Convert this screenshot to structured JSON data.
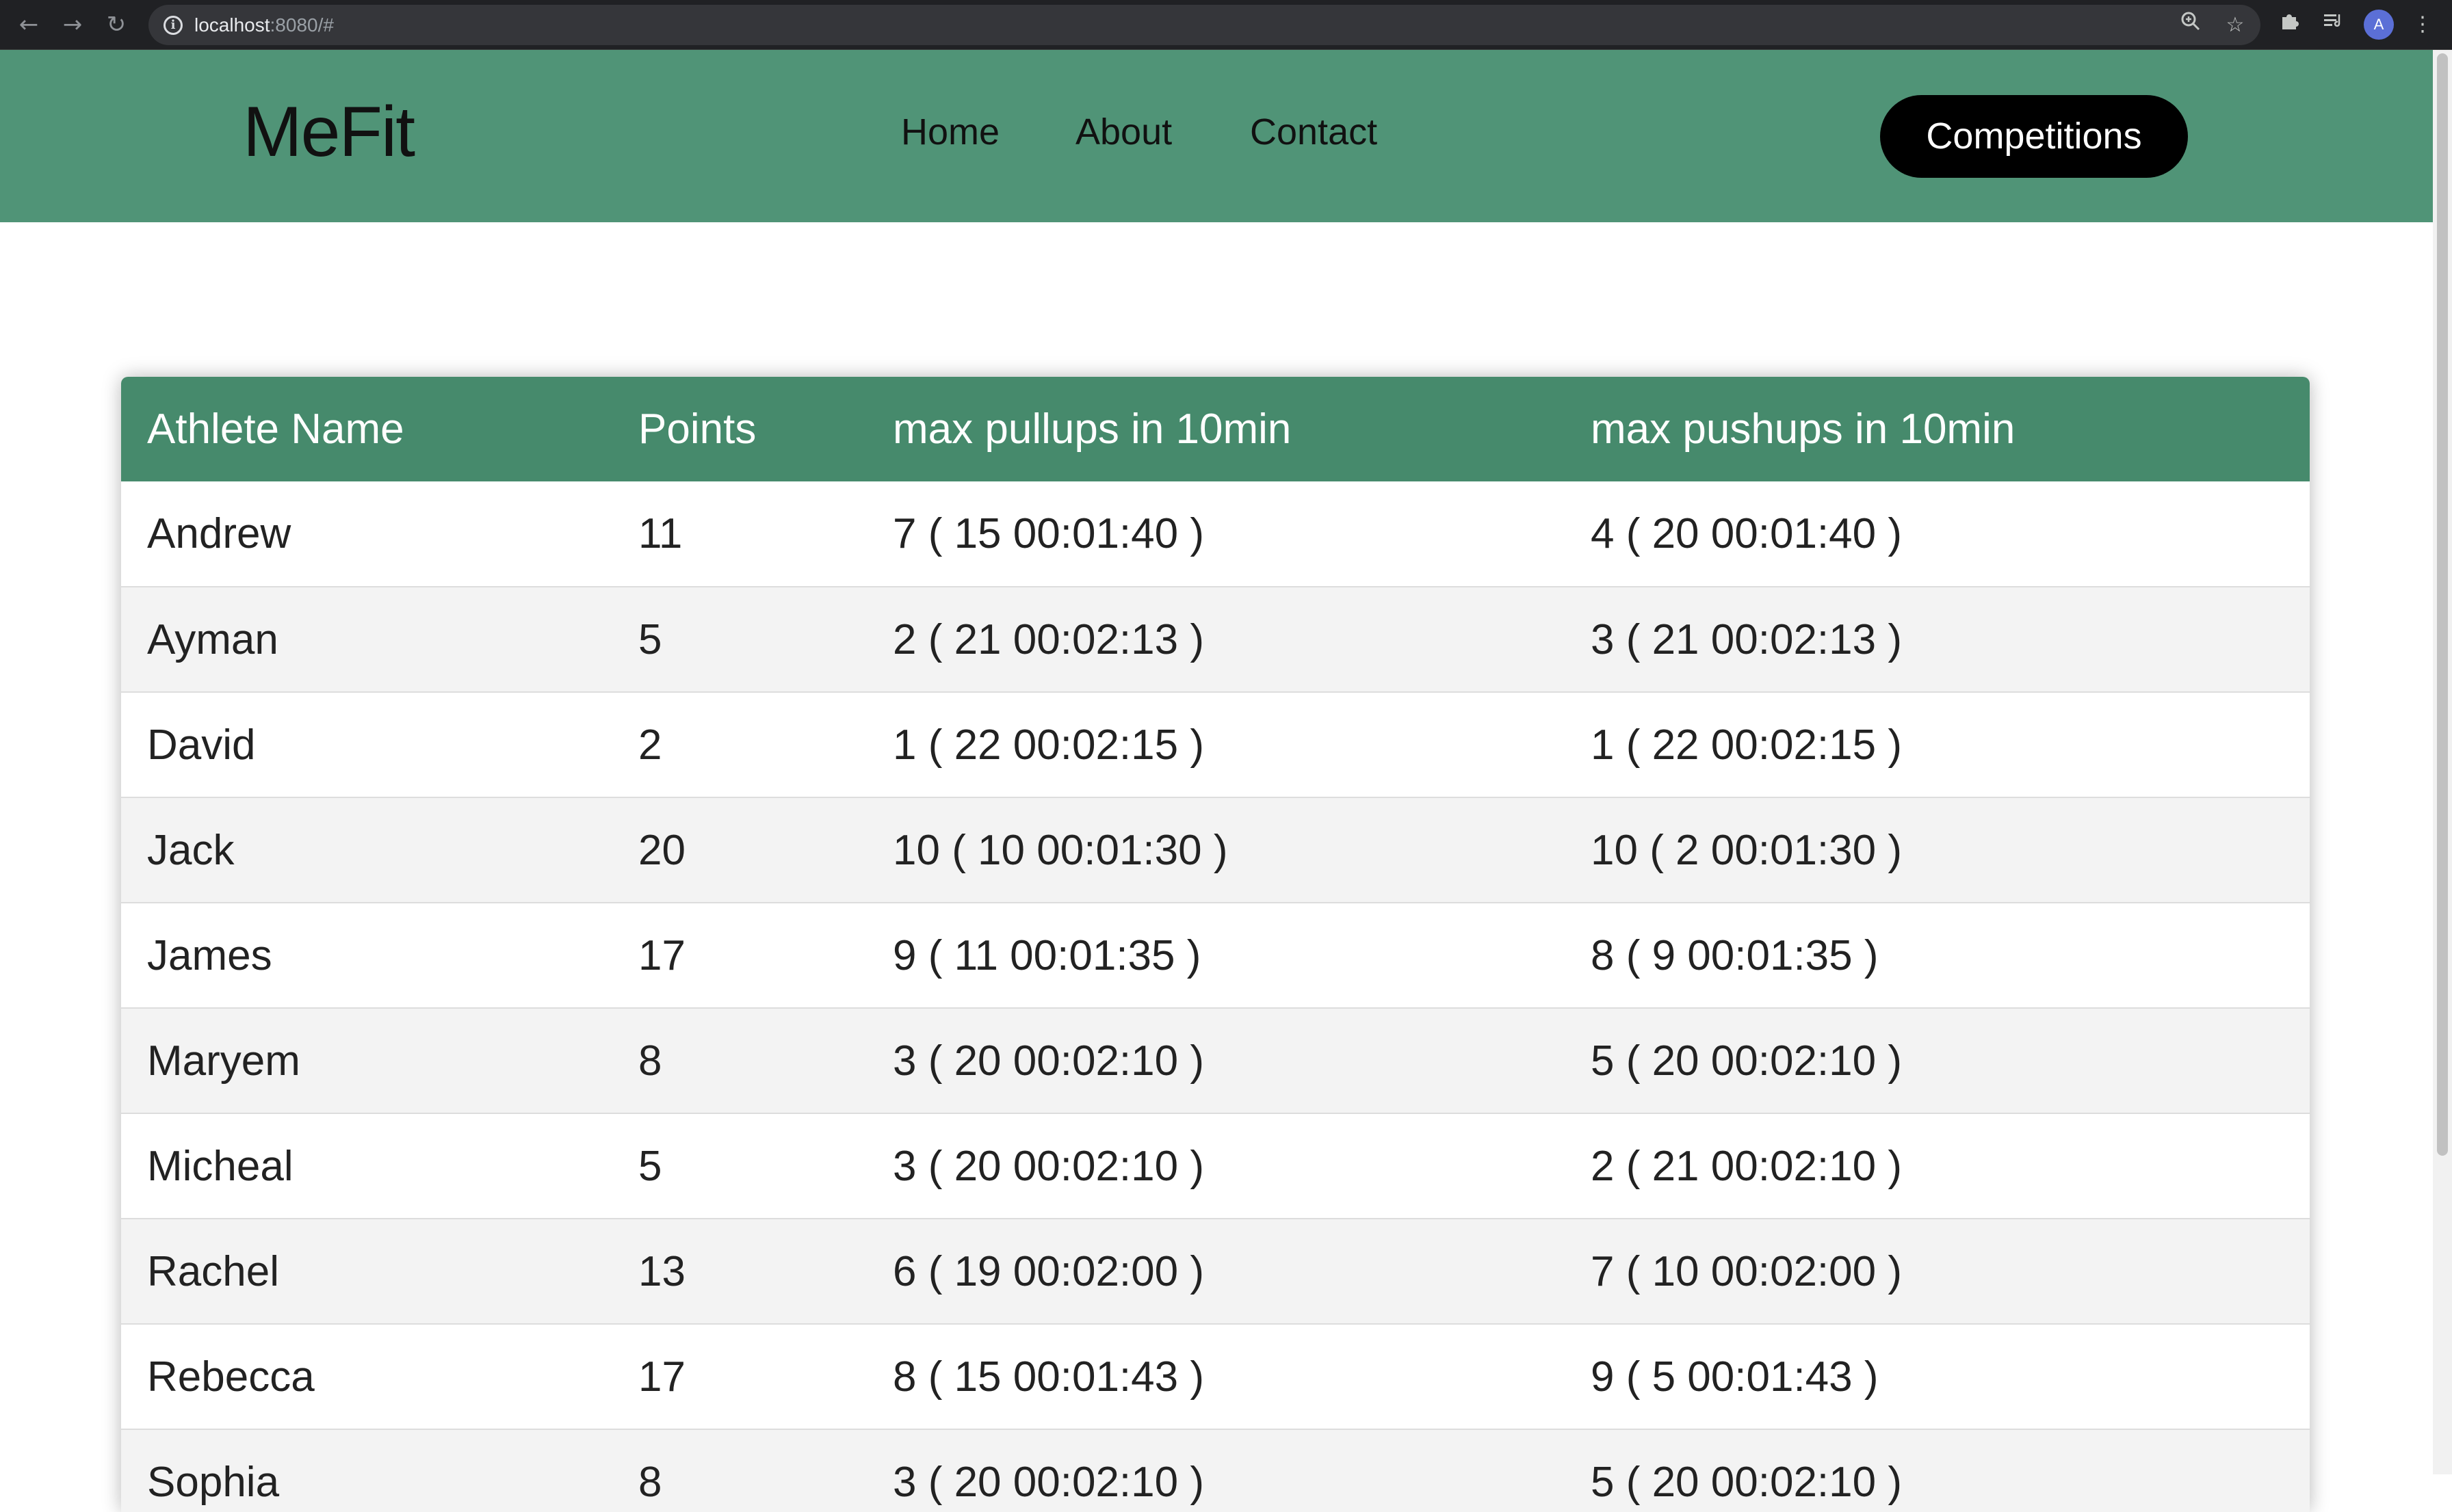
{
  "browser": {
    "url_host": "localhost",
    "url_rest": ":8080/#",
    "icons": {
      "back": "arrow-left-icon",
      "forward": "arrow-right-icon",
      "reload": "reload-icon",
      "info": "info-icon",
      "zoom": "zoom-icon",
      "bookmark": "star-icon",
      "extensions": "puzzle-icon",
      "media": "media-queue-icon",
      "menu": "kebab-menu-icon"
    },
    "profile_initial": "A"
  },
  "header": {
    "logo": "MeFit",
    "nav": {
      "home": "Home",
      "about": "About",
      "contact": "Contact"
    },
    "cta_label": "Competitions",
    "background_color": "#509477"
  },
  "table": {
    "header_color": "#468a6c",
    "columns": [
      "Athlete Name",
      "Points",
      "max pullups in 10min",
      "max pushups in 10min"
    ],
    "rows": [
      {
        "name": "Andrew",
        "points": "11",
        "pullups": "7 ( 15 00:01:40 )",
        "pushups": "4 ( 20 00:01:40 )"
      },
      {
        "name": "Ayman",
        "points": "5",
        "pullups": "2 ( 21 00:02:13 )",
        "pushups": "3 ( 21 00:02:13 )"
      },
      {
        "name": "David",
        "points": "2",
        "pullups": "1 ( 22 00:02:15 )",
        "pushups": "1 ( 22 00:02:15 )"
      },
      {
        "name": "Jack",
        "points": "20",
        "pullups": "10 ( 10 00:01:30 )",
        "pushups": "10 ( 2 00:01:30 )"
      },
      {
        "name": "James",
        "points": "17",
        "pullups": "9 ( 11 00:01:35 )",
        "pushups": "8 ( 9 00:01:35 )"
      },
      {
        "name": "Maryem",
        "points": "8",
        "pullups": "3 ( 20 00:02:10 )",
        "pushups": "5 ( 20 00:02:10 )"
      },
      {
        "name": "Micheal",
        "points": "5",
        "pullups": "3 ( 20 00:02:10 )",
        "pushups": "2 ( 21 00:02:10 )"
      },
      {
        "name": "Rachel",
        "points": "13",
        "pullups": "6 ( 19 00:02:00 )",
        "pushups": "7 ( 10 00:02:00 )"
      },
      {
        "name": "Rebecca",
        "points": "17",
        "pullups": "8 ( 15 00:01:43 )",
        "pushups": "9 ( 5 00:01:43 )"
      },
      {
        "name": "Sophia",
        "points": "8",
        "pullups": "3 ( 20 00:02:10 )",
        "pushups": "5 ( 20 00:02:10 )"
      }
    ]
  }
}
